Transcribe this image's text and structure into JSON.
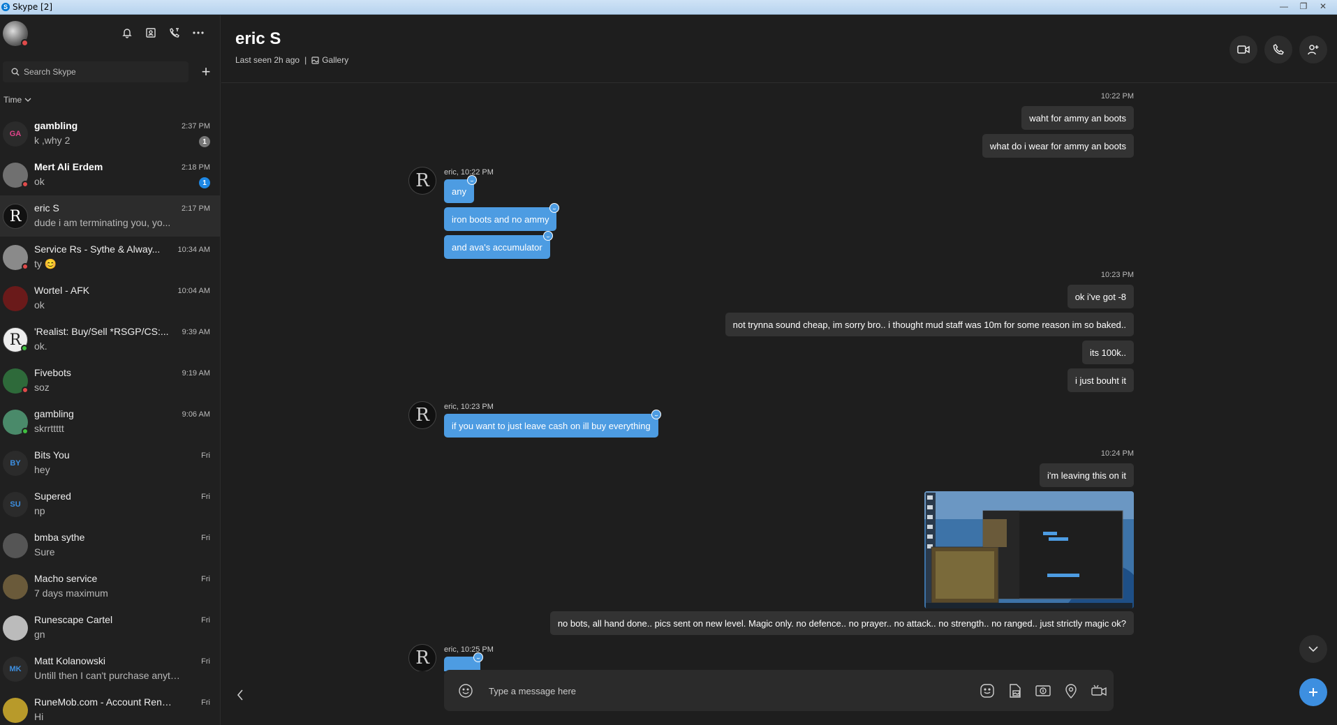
{
  "window": {
    "title": "Skype [2]",
    "controls": [
      "—",
      "❐",
      "✕"
    ]
  },
  "sidebar": {
    "header_icons": [
      "bell-icon",
      "contacts-icon",
      "call-log-icon",
      "more-icon"
    ],
    "search": {
      "placeholder": "Search Skype"
    },
    "new_chat": "+",
    "sort": {
      "label": "Time"
    },
    "conversations": [
      {
        "name": "gambling",
        "preview": "k ,why 2",
        "time": "2:37 PM",
        "bold": true,
        "badge": "1",
        "badge_color": "#777777",
        "initials": "GA",
        "avatar_color": "#2b2b2b",
        "initials_color": "#e0448a"
      },
      {
        "name": "Mert Ali Erdem",
        "preview": "ok",
        "time": "2:18 PM",
        "bold": true,
        "badge": "1",
        "badge_color": "#1e88e5",
        "initials": "",
        "avatar_color": "#707070",
        "status": "#e04a4a"
      },
      {
        "name": "eric S",
        "preview": "dude i am terminating you, yo...",
        "time": "2:17 PM",
        "bold": false,
        "initials": "R",
        "avatar_color": "#111111",
        "active": true
      },
      {
        "name": "Service Rs - Sythe & Alway...",
        "preview": "ty 😊",
        "time": "10:34 AM",
        "bold": false,
        "initials": "",
        "avatar_color": "#8a8a8a",
        "status": "#e04a4a"
      },
      {
        "name": "Wortel - AFK",
        "preview": "ok",
        "time": "10:04 AM",
        "bold": false,
        "initials": "",
        "avatar_color": "#6a1a1a"
      },
      {
        "name": "'Realist: Buy/Sell *RSGP/CS:...",
        "preview": "ok.",
        "time": "9:39 AM",
        "bold": false,
        "initials": "R",
        "avatar_color": "#eeeeee",
        "initials_color": "#222222",
        "status": "#3fbf3f"
      },
      {
        "name": "Fivebots",
        "preview": "soz",
        "time": "9:19 AM",
        "bold": false,
        "initials": "",
        "avatar_color": "#2e6a3a",
        "status": "#e04a4a"
      },
      {
        "name": "gambling",
        "preview": "skrrttttt",
        "time": "9:06 AM",
        "bold": false,
        "initials": "",
        "avatar_color": "#4a8a6a",
        "status": "#3fbf3f"
      },
      {
        "name": "Bits You",
        "preview": "hey",
        "time": "Fri",
        "bold": false,
        "initials": "BY",
        "avatar_color": "#2b2b2b",
        "initials_color": "#3d8fe0"
      },
      {
        "name": "Supered",
        "preview": "np",
        "time": "Fri",
        "bold": false,
        "initials": "SU",
        "avatar_color": "#2b2b2b",
        "initials_color": "#3d8fe0"
      },
      {
        "name": "bmba sythe",
        "preview": "Sure",
        "time": "Fri",
        "bold": false,
        "initials": "",
        "avatar_color": "#555555"
      },
      {
        "name": "Macho service",
        "preview": "7 days maximum",
        "time": "Fri",
        "bold": false,
        "initials": "",
        "avatar_color": "#6a5a3a"
      },
      {
        "name": "Runescape Cartel",
        "preview": "gn",
        "time": "Fri",
        "bold": false,
        "initials": "",
        "avatar_color": "#bbbbbb"
      },
      {
        "name": "Matt Kolanowski",
        "preview": "Untill then I can't purchase anythin...",
        "time": "Fri",
        "bold": false,
        "initials": "MK",
        "avatar_color": "#2b2b2b",
        "initials_color": "#3d8fe0"
      },
      {
        "name": "RuneMob.com - Account Rentals...",
        "preview": "Hi",
        "time": "Fri",
        "bold": false,
        "initials": "",
        "avatar_color": "#b89a2a"
      }
    ]
  },
  "chat": {
    "title": "eric S",
    "last_seen": "Last seen 2h ago",
    "separator": "|",
    "gallery_label": "Gallery",
    "header_buttons": [
      "video-call-icon",
      "audio-call-icon",
      "add-person-icon"
    ],
    "timestamps": [
      "10:22 PM",
      "10:23 PM",
      "10:24 PM"
    ],
    "outgoing": [
      "waht for ammy an boots",
      "what do i wear for ammy an boots",
      "ok i've got -8",
      "not trynna sound cheap, im sorry bro.. i thought mud staff was 10m for some reason im so baked..",
      "its 100k..",
      "i just bouht it",
      "i'm leaving this on it",
      "no bots, all hand done.. pics sent on new level. Magic only. no defence.. no prayer.. no attack.. no strength.. no ranged.. just strictly magic ok?"
    ],
    "incoming_meta": [
      "eric, 10:22 PM",
      "eric, 10:23 PM",
      "eric, 10:25 PM"
    ],
    "incoming": [
      "any",
      "iron boots and no ammy",
      "and ava's accumulator",
      "if you want to just leave cash on ill buy everything"
    ],
    "avatar_glyph": "R"
  },
  "composer": {
    "placeholder": "Type a message here",
    "tools": [
      "sticker-icon",
      "file-share-icon",
      "money-icon",
      "location-icon",
      "video-message-icon"
    ]
  }
}
